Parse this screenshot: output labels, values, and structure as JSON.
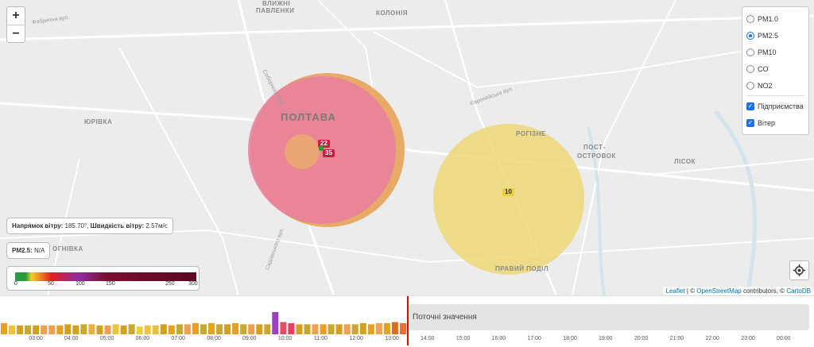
{
  "places": {
    "city": "ПОЛТАВА",
    "yurivka": "ЮРІВКА",
    "pavlenky_top": "ВЛИЖНІ",
    "pavlenky": "ПАВЛЕНКИ",
    "koloniya": "КОЛОНІЯ",
    "rohizne": "РОГІЗНЕ",
    "post": "ПОСТ-",
    "ostrovok": "ОСТРОВОК",
    "lisok": "ЛІСОК",
    "pravyi": "ПРАВИЙ ПОДІЛ",
    "ohnivka": "ОГНІВКА",
    "st1": "Фабрична вул.",
    "st2": "Соборності вул.",
    "st3": "Європейська вул.",
    "st4": "Садовського вул."
  },
  "zoom": {
    "in": "+",
    "out": "−"
  },
  "layers": {
    "pollutants": [
      {
        "label": "PM1.0",
        "selected": false
      },
      {
        "label": "PM2.5",
        "selected": true
      },
      {
        "label": "PM10",
        "selected": false
      },
      {
        "label": "CO",
        "selected": false
      },
      {
        "label": "NO2",
        "selected": false
      }
    ],
    "overlays": [
      {
        "label": "Підприємства",
        "checked": true
      },
      {
        "label": "Вітер",
        "checked": true
      }
    ]
  },
  "wind": {
    "dir_label": "Напрямок вітру:",
    "dir_value": "185.70°,",
    "speed_label": "Швидкість вітру:",
    "speed_value": "2.57м/с"
  },
  "pm_info": {
    "label": "PM2.5:",
    "value": "N/A"
  },
  "legend": {
    "labels": [
      "0",
      "50",
      "100",
      "150",
      "250",
      "300"
    ],
    "colors": [
      "#2e9a3e",
      "#f0d020",
      "#f08020",
      "#e02020",
      "#8e2ea0",
      "#7a1030"
    ]
  },
  "markers": [
    {
      "text": "22",
      "color": "#c8203c"
    },
    {
      "text": "35",
      "color": "#c8203c"
    },
    {
      "text": "10",
      "color": "#e8d040"
    }
  ],
  "attribution": {
    "leaflet": "Leaflet",
    "sep1": " | © ",
    "osm": "OpenStreetMap",
    "mid": " contributors, © ",
    "carto": "CartoDB"
  },
  "timeline": {
    "current_label": "Поточні значення",
    "ticks": [
      "03:00",
      "04:00",
      "05:00",
      "06:00",
      "07:00",
      "08:00",
      "09:00",
      "10:00",
      "11:00",
      "12:00",
      "13:00",
      "14:00",
      "15:00",
      "16:00",
      "17:00",
      "18:00",
      "19:00",
      "20:00",
      "21:00",
      "22:00",
      "23:00",
      "00:00"
    ],
    "bars": [
      {
        "v": 0.5,
        "c": "#e8a020"
      },
      {
        "v": 0.4,
        "c": "#f0c040"
      },
      {
        "v": 0.4,
        "c": "#d4a020"
      },
      {
        "v": 0.4,
        "c": "#c8a830"
      },
      {
        "v": 0.4,
        "c": "#d4a020"
      },
      {
        "v": 0.4,
        "c": "#f0a050"
      },
      {
        "v": 0.4,
        "c": "#f0a050"
      },
      {
        "v": 0.4,
        "c": "#e8a020"
      },
      {
        "v": 0.45,
        "c": "#d4a020"
      },
      {
        "v": 0.4,
        "c": "#d4a020"
      },
      {
        "v": 0.45,
        "c": "#c8a830"
      },
      {
        "v": 0.45,
        "c": "#e8b040"
      },
      {
        "v": 0.4,
        "c": "#d4a020"
      },
      {
        "v": 0.4,
        "c": "#f0a050"
      },
      {
        "v": 0.45,
        "c": "#f0c040"
      },
      {
        "v": 0.4,
        "c": "#d4a020"
      },
      {
        "v": 0.45,
        "c": "#c8a830"
      },
      {
        "v": 0.35,
        "c": "#e8d040"
      },
      {
        "v": 0.4,
        "c": "#f0c040"
      },
      {
        "v": 0.4,
        "c": "#e8c040"
      },
      {
        "v": 0.45,
        "c": "#d4a020"
      },
      {
        "v": 0.4,
        "c": "#e8a020"
      },
      {
        "v": 0.45,
        "c": "#c8a830"
      },
      {
        "v": 0.45,
        "c": "#f0a050"
      },
      {
        "v": 0.5,
        "c": "#e8a020"
      },
      {
        "v": 0.45,
        "c": "#c8a830"
      },
      {
        "v": 0.5,
        "c": "#e8a020"
      },
      {
        "v": 0.45,
        "c": "#c8a830"
      },
      {
        "v": 0.45,
        "c": "#d4a020"
      },
      {
        "v": 0.5,
        "c": "#e8a020"
      },
      {
        "v": 0.45,
        "c": "#c8a830"
      },
      {
        "v": 0.45,
        "c": "#f0a050"
      },
      {
        "v": 0.45,
        "c": "#d4a020"
      },
      {
        "v": 0.45,
        "c": "#c8a830"
      },
      {
        "v": 1.0,
        "c": "#9a40c0"
      },
      {
        "v": 0.55,
        "c": "#e05060"
      },
      {
        "v": 0.5,
        "c": "#e84060"
      },
      {
        "v": 0.45,
        "c": "#d4a020"
      },
      {
        "v": 0.45,
        "c": "#c8a830"
      },
      {
        "v": 0.45,
        "c": "#f0a050"
      },
      {
        "v": 0.45,
        "c": "#e8a020"
      },
      {
        "v": 0.45,
        "c": "#c8a830"
      },
      {
        "v": 0.45,
        "c": "#d4a020"
      },
      {
        "v": 0.45,
        "c": "#f0a050"
      },
      {
        "v": 0.45,
        "c": "#c8a830"
      },
      {
        "v": 0.5,
        "c": "#d4a020"
      },
      {
        "v": 0.45,
        "c": "#e8a020"
      },
      {
        "v": 0.5,
        "c": "#f0a050"
      },
      {
        "v": 0.5,
        "c": "#e8a020"
      },
      {
        "v": 0.55,
        "c": "#d87020"
      },
      {
        "v": 0.5,
        "c": "#e87030"
      }
    ]
  }
}
